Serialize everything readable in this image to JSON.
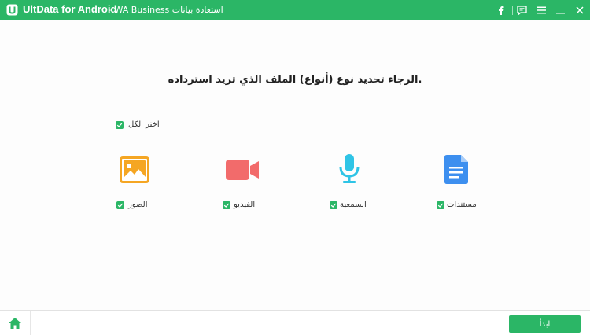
{
  "titlebar": {
    "app_name": "UltData for Android",
    "subtitle": "- WA Business استعادة بيانات",
    "buttons": [
      "facebook-icon",
      "feedback-icon",
      "menu-icon",
      "minimize-icon",
      "close-icon"
    ]
  },
  "main": {
    "heading": ".الرجاء تحديد نوع (أنواع) الملف الذي تريد استرداده",
    "select_all": {
      "label": "اختر الكل",
      "checked": true
    },
    "file_types": [
      {
        "label": "الصور",
        "icon": "image-icon",
        "color": "#f5a623",
        "checked": true
      },
      {
        "label": "الفيديو",
        "icon": "video-icon",
        "color": "#f26b6b",
        "checked": true
      },
      {
        "label": "السمعية",
        "icon": "microphone-icon",
        "color": "#2fc4e6",
        "checked": true
      },
      {
        "label": "مستندات",
        "icon": "document-icon",
        "color": "#3d8fef",
        "checked": true
      }
    ]
  },
  "footer": {
    "start_label": "ابدأ"
  },
  "colors": {
    "accent": "#2bb666"
  }
}
